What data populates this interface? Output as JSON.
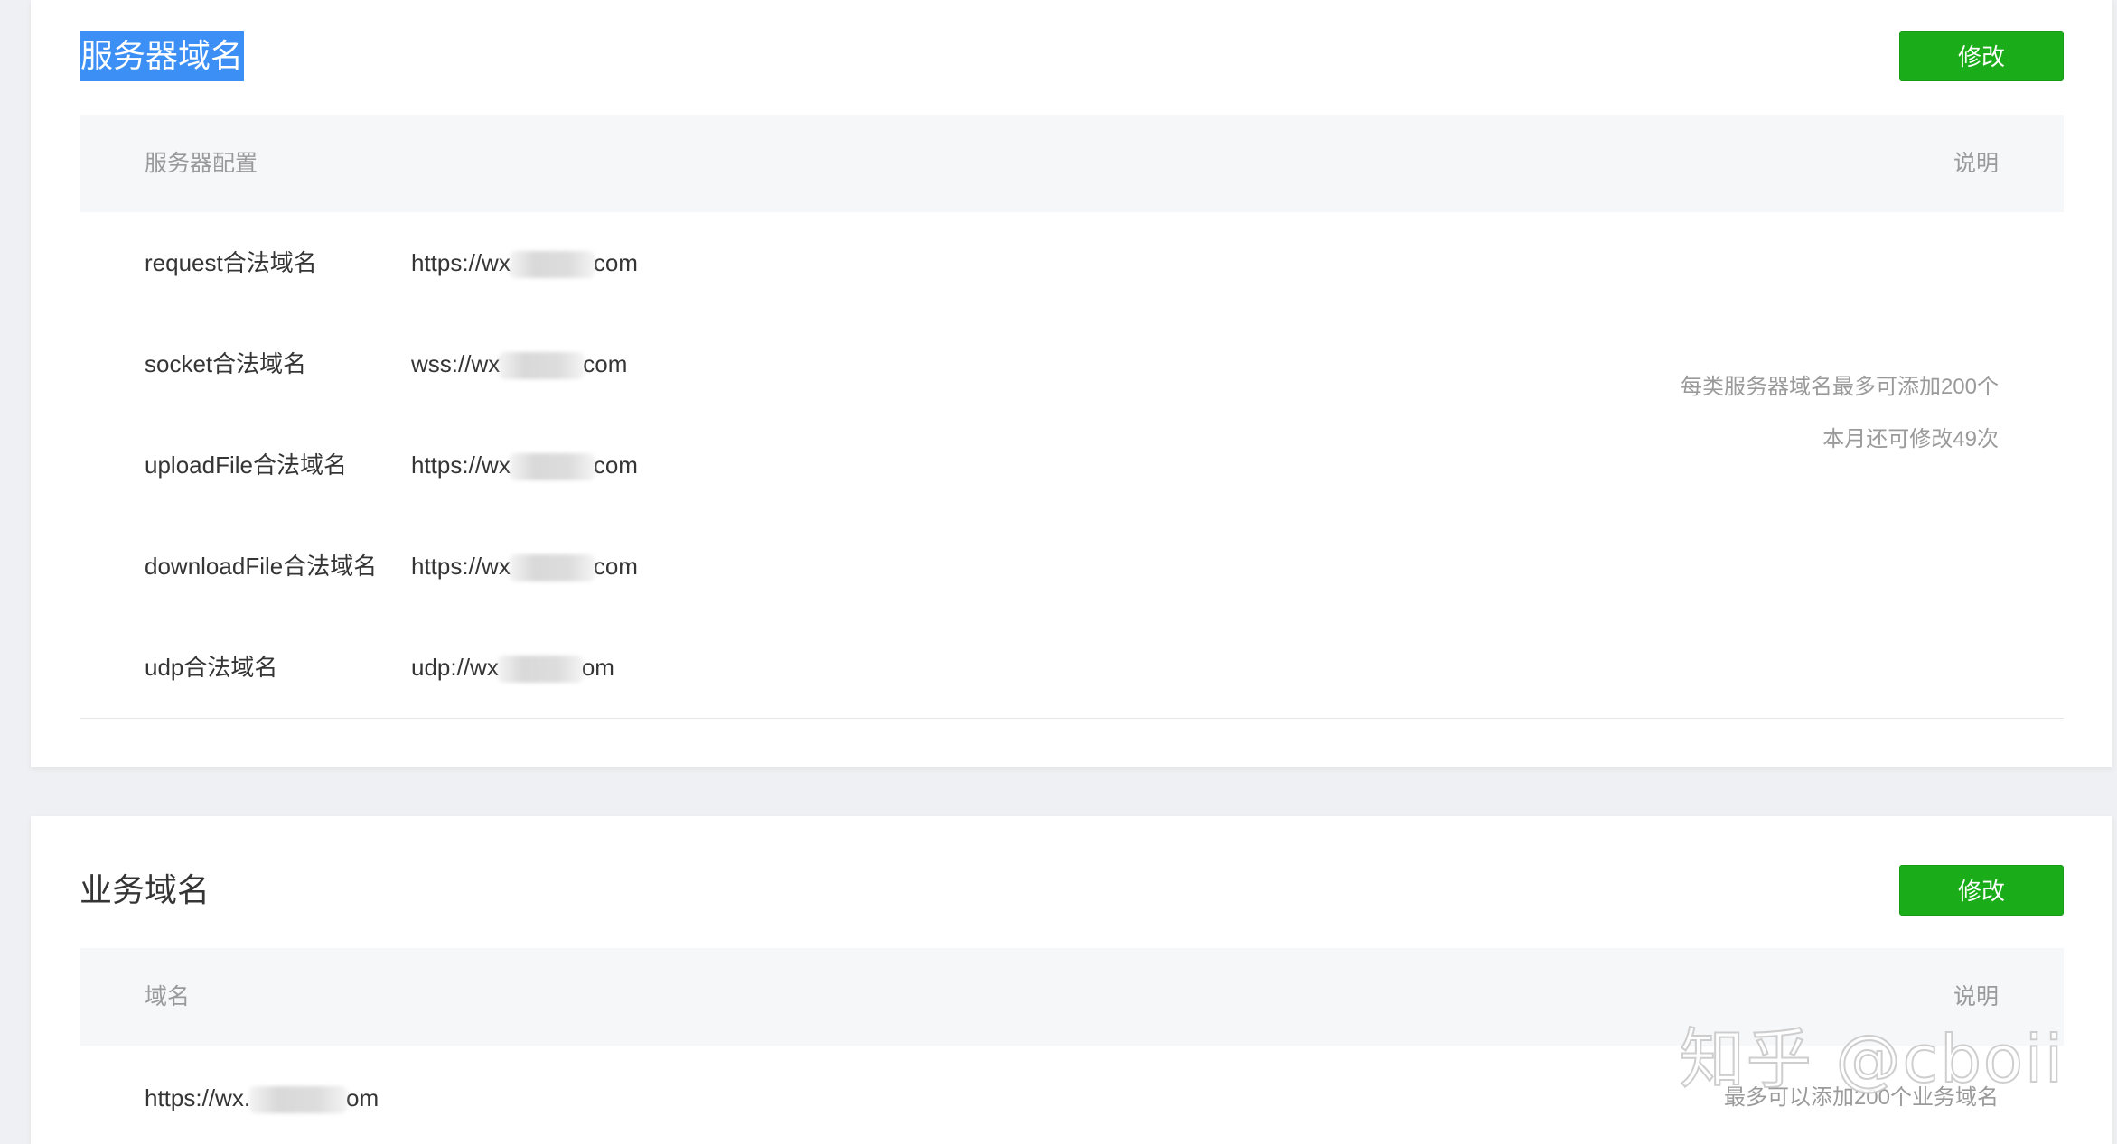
{
  "server_domains": {
    "title": "服务器域名",
    "edit_label": "修改",
    "col_config": "服务器配置",
    "col_desc": "说明",
    "rows": [
      {
        "label": "request合法域名",
        "value_prefix": "https://wx",
        "value_suffix": "com"
      },
      {
        "label": "socket合法域名",
        "value_prefix": "wss://wx",
        "value_suffix": "com"
      },
      {
        "label": "uploadFile合法域名",
        "value_prefix": "https://wx",
        "value_suffix": "com"
      },
      {
        "label": "downloadFile合法域名",
        "value_prefix": "https://wx",
        "value_suffix": "com"
      },
      {
        "label": "udp合法域名",
        "value_prefix": "udp://wx",
        "value_suffix": "om"
      }
    ],
    "note_line1": "每类服务器域名最多可添加200个",
    "note_line2": "本月还可修改49次"
  },
  "business_domains": {
    "title": "业务域名",
    "edit_label": "修改",
    "col_domain": "域名",
    "col_desc": "说明",
    "rows": [
      {
        "value_prefix": "https://wx.",
        "value_suffix": "om"
      }
    ],
    "note": "最多可以添加200个业务域名"
  },
  "watermark": "知乎 @cboii"
}
